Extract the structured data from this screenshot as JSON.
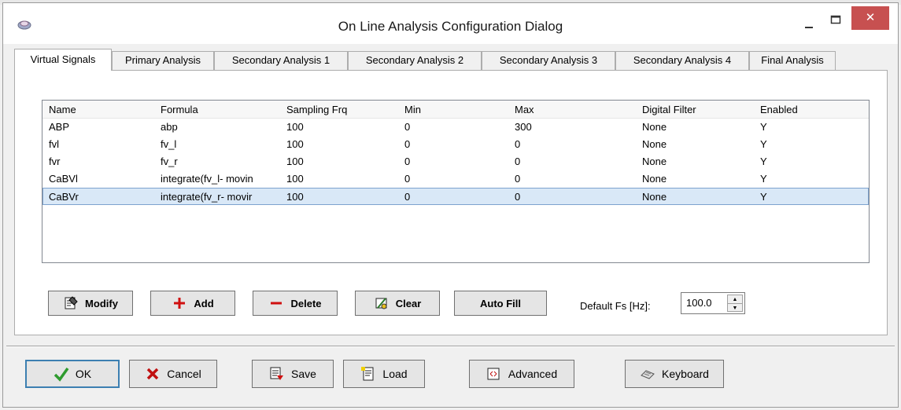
{
  "window": {
    "title": "On Line Analysis Configuration Dialog",
    "close_symbol": "✕"
  },
  "tabs": [
    {
      "label": "Virtual Signals",
      "active": true
    },
    {
      "label": "Primary Analysis"
    },
    {
      "label": "Secondary Analysis 1"
    },
    {
      "label": "Secondary Analysis 2"
    },
    {
      "label": "Secondary Analysis 3"
    },
    {
      "label": "Secondary Analysis 4"
    },
    {
      "label": "Final Analysis"
    }
  ],
  "signals": {
    "columns": [
      "Name",
      "Formula",
      "Sampling Frq",
      "Min",
      "Max",
      "Digital Filter",
      "Enabled"
    ],
    "rows": [
      [
        "ABP",
        "abp",
        "100",
        "0",
        "300",
        "None",
        "Y"
      ],
      [
        "fvl",
        "fv_l",
        "100",
        "0",
        "0",
        "None",
        "Y"
      ],
      [
        "fvr",
        "fv_r",
        "100",
        "0",
        "0",
        "None",
        "Y"
      ],
      [
        "CaBVl",
        "integrate(fv_l- movin",
        "100",
        "0",
        "0",
        "None",
        "Y"
      ],
      [
        "CaBVr",
        "integrate(fv_r- movir",
        "100",
        "0",
        "0",
        "None",
        "Y"
      ]
    ],
    "selected_row": 4
  },
  "actions": {
    "modify": "Modify",
    "add": "Add",
    "delete": "Delete",
    "clear": "Clear",
    "auto_fill": "Auto Fill"
  },
  "default_fs": {
    "label": "Default Fs [Hz]:",
    "value": "100.0"
  },
  "footer": {
    "ok": "OK",
    "cancel": "Cancel",
    "save": "Save",
    "load": "Load",
    "advanced": "Advanced",
    "keyboard": "Keyboard"
  },
  "colors": {
    "close_button": "#c75050",
    "selection": "#d9e8f7",
    "ok_check": "#2e9b2e",
    "add_plus": "#d01010",
    "delete_minus": "#d01010",
    "cancel_x": "#c01010"
  }
}
